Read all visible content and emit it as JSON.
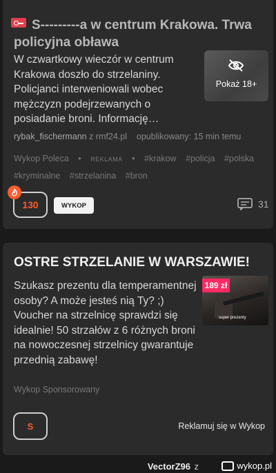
{
  "post": {
    "title": "S---------a w centrum Krakowa. Trwa policyjna obława",
    "description": "W czwartkowy wieczór w centrum Krakowa doszło do strzelaniny. Policjanci interweniowali wobec mężczyzn podejrzewanych o posiadanie broni. Informację…",
    "thumbnail_label": "Pokaż 18+",
    "author": "rybak_fischermann",
    "source_prefix": "z",
    "source": "rmf24.pl",
    "published": "opublikowany: 15 min temu",
    "tags": [
      "Wykop Poleca",
      "•",
      "REKLAMA",
      "•",
      "#krakow",
      "#policja",
      "#polska",
      "#kryminalne",
      "#strzelanina",
      "#bron"
    ],
    "votes": "130",
    "wykop_label": "WYKOP",
    "comments": "31",
    "colors": {
      "accent": "#ff5c2d",
      "flag": "#e0414c"
    }
  },
  "ad": {
    "title": "OSTRE STRZELANIE W WARSZAWIE!",
    "description": "Szukasz prezentu dla temperamentnej osoby? A może jesteś nią Ty? ;) Voucher na strzelnicę sprawdzi się idealnie! 50 strzałów z 6 różnych broni na nowoczesnej strzelnicy gwarantuje przednią zabawę!",
    "price": "189 zł",
    "logo_text": "super prezenty",
    "sponsored": "Wykop Sponsorowany",
    "vote_label": "S",
    "advertise": "Reklamuj się w Wykop",
    "colors": {
      "price_badge": "#ff2a63"
    }
  },
  "footer": {
    "username": "VectorZ96",
    "z": "z",
    "brand": "wykop.pl"
  }
}
